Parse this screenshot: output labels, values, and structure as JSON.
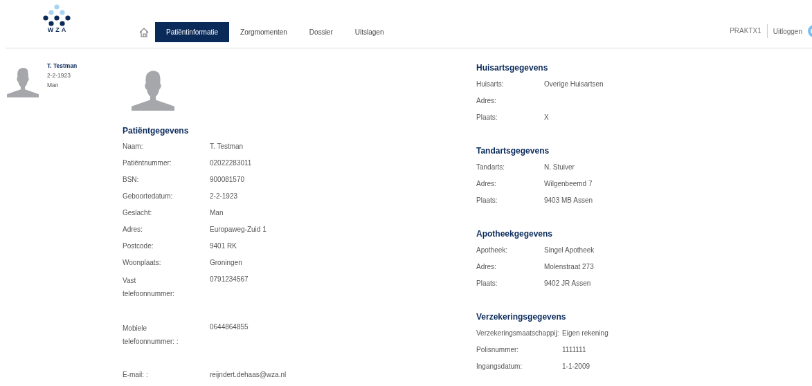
{
  "header": {
    "logo_text": "WZA",
    "nav": [
      {
        "label": "Patiëntinformatie",
        "selected": true
      },
      {
        "label": "Zorgmomenten",
        "selected": false
      },
      {
        "label": "Dossier",
        "selected": false
      },
      {
        "label": "Uitslagen",
        "selected": false
      }
    ],
    "user": "PRAKTX1",
    "logout": "Uitloggen"
  },
  "sidebar": {
    "name": "T. Testman",
    "birth_date": "2-2-1923",
    "gender": "Man"
  },
  "patient": {
    "title": "Patiëntgegevens",
    "rows": [
      {
        "label": "Naam:",
        "value": "T. Testman"
      },
      {
        "label": "Patiëntnummer:",
        "value": "02022283011"
      },
      {
        "label": "BSN:",
        "value": "900081570"
      },
      {
        "label": "Geboortedatum:",
        "value": "2-2-1923"
      },
      {
        "label": "Geslacht:",
        "value": "Man"
      },
      {
        "label": "Adres:",
        "value": "Europaweg-Zuid 1"
      },
      {
        "label": "Postcode:",
        "value": "9401 RK"
      },
      {
        "label": "Woonplaats:",
        "value": "Groningen"
      },
      {
        "label": "Vast telefoonnummer:",
        "value": "0791234567"
      },
      {
        "label": "Mobiele telefoonnummer: :",
        "value": "0644864855"
      },
      {
        "label": "E-mail: :",
        "value": "reijndert.dehaas@wza.nl"
      }
    ]
  },
  "sections": [
    {
      "title": "Huisartsgegevens",
      "rows": [
        {
          "label": "Huisarts:",
          "value": "Overige Huisartsen"
        },
        {
          "label": "Adres:"
        },
        {
          "label": "Plaats:",
          "value": "X"
        }
      ]
    },
    {
      "title": "Tandartsgegevens",
      "rows": [
        {
          "label": "Tandarts:",
          "value": "N. Stuiver"
        },
        {
          "label": "Adres:",
          "value": "Wilgenbeemd 7"
        },
        {
          "label": "Plaats:",
          "value": "9403 MB  Assen"
        }
      ]
    },
    {
      "title": "Apotheekgegevens",
      "rows": [
        {
          "label": "Apotheek:",
          "value": "Singel Apotheek"
        },
        {
          "label": "Adres:",
          "value": "Molenstraat 273"
        },
        {
          "label": "Plaats:",
          "value": "9402 JR  Assen"
        }
      ]
    },
    {
      "title": "Verzekeringsgegevens",
      "rows": [
        {
          "label": "Verzekeringsmaatschappij:",
          "value": "Eigen rekening"
        },
        {
          "label": "Polisnummer:",
          "value": "1111111"
        },
        {
          "label": "Ingangsdatum:",
          "value": "1-1-2009"
        }
      ]
    }
  ]
}
